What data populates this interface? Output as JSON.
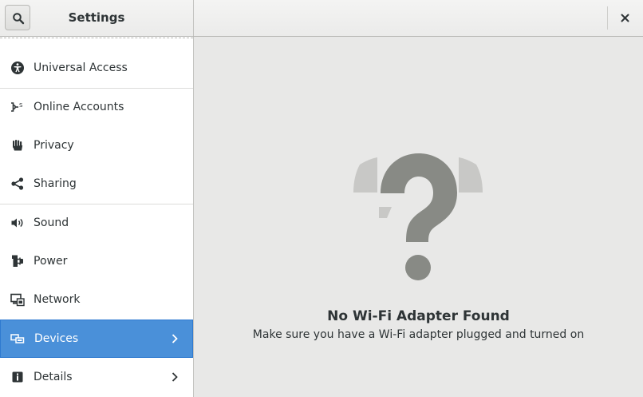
{
  "window": {
    "title": "Settings"
  },
  "sidebar": {
    "items": [
      {
        "label": "Universal Access",
        "icon": "accessibility-icon"
      },
      {
        "label": "Online Accounts",
        "icon": "online-accounts-icon"
      },
      {
        "label": "Privacy",
        "icon": "privacy-hand-icon"
      },
      {
        "label": "Sharing",
        "icon": "share-icon"
      },
      {
        "label": "Sound",
        "icon": "speaker-icon"
      },
      {
        "label": "Power",
        "icon": "power-plug-icon"
      },
      {
        "label": "Network",
        "icon": "network-icon"
      },
      {
        "label": "Devices",
        "icon": "devices-icon",
        "selected": true,
        "has_children": true
      },
      {
        "label": "Details",
        "icon": "info-icon",
        "has_children": true
      }
    ]
  },
  "main": {
    "status_icon": "question-mark-icon",
    "title": "No Wi-Fi Adapter Found",
    "subtitle": "Make sure you have a Wi-Fi adapter plugged and turned on"
  },
  "colors": {
    "accent": "#4a90d9",
    "sidebar_bg": "#ffffff",
    "content_bg": "#e8e8e7",
    "icon_gray": "#888a85"
  }
}
